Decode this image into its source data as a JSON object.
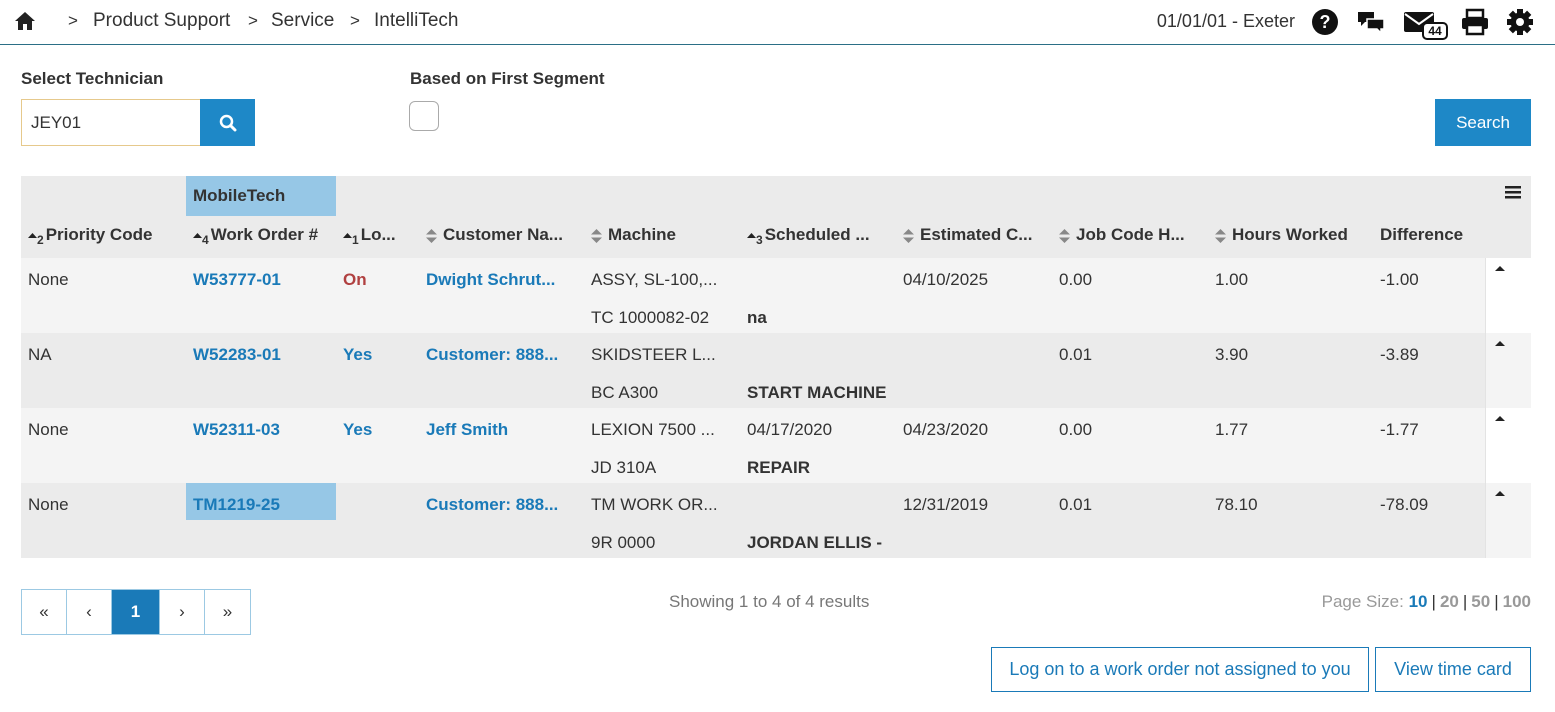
{
  "breadcrumb": {
    "separator": ">",
    "items": [
      "Product Support",
      "Service",
      "IntelliTech"
    ]
  },
  "header": {
    "location": "01/01/01 - Exeter",
    "mail_count": "44"
  },
  "filters": {
    "technician_label": "Select Technician",
    "technician_value": "JEY01",
    "first_segment_label": "Based on First Segment",
    "search_label": "Search"
  },
  "table": {
    "group_header": "MobileTech",
    "columns": [
      {
        "label": "Priority Code",
        "sort_order": "2"
      },
      {
        "label": "Work Order #",
        "sort_order": "4"
      },
      {
        "label": "Lo...",
        "sort_order": "1"
      },
      {
        "label": "Customer Na...",
        "sort_order": ""
      },
      {
        "label": "Machine",
        "sort_order": ""
      },
      {
        "label": "Scheduled ...",
        "sort_order": "3"
      },
      {
        "label": "Estimated C...",
        "sort_order": ""
      },
      {
        "label": "Job Code H...",
        "sort_order": ""
      },
      {
        "label": "Hours Worked",
        "sort_order": ""
      },
      {
        "label": "Difference",
        "sort_order": ""
      }
    ],
    "rows": [
      {
        "priority": "None",
        "work_order": "W53777-01",
        "logged": "On",
        "customer": "Dwight Schrut...",
        "machine": "ASSY, SL-100,...",
        "machine_code": "TC 1000082-02",
        "scheduled": "",
        "job_desc": "na",
        "estimated": "04/10/2025",
        "job_code_hours": "0.00",
        "hours_worked": "1.00",
        "difference": "-1.00"
      },
      {
        "priority": "NA",
        "work_order": "W52283-01",
        "logged": "Yes",
        "customer": "Customer: 888...",
        "machine": "SKIDSTEER L...",
        "machine_code": "BC A300",
        "scheduled": "",
        "job_desc": "START MACHINE",
        "estimated": "",
        "job_code_hours": "0.01",
        "hours_worked": "3.90",
        "difference": "-3.89"
      },
      {
        "priority": "None",
        "work_order": "W52311-03",
        "logged": "Yes",
        "customer": "Jeff Smith",
        "machine": "LEXION 7500 ...",
        "machine_code": "JD 310A",
        "scheduled": "04/17/2020",
        "job_desc": "REPAIR",
        "estimated": "04/23/2020",
        "job_code_hours": "0.00",
        "hours_worked": "1.77",
        "difference": "-1.77"
      },
      {
        "priority": "None",
        "work_order": "TM1219-25",
        "logged": "",
        "customer": "Customer: 888...",
        "machine": "TM WORK OR...",
        "machine_code": "9R 0000",
        "scheduled": "",
        "job_desc": "JORDAN ELLIS -",
        "estimated": "12/31/2019",
        "job_code_hours": "0.01",
        "hours_worked": "78.10",
        "difference": "-78.09"
      }
    ]
  },
  "pagination": {
    "first": "«",
    "prev": "‹",
    "current": "1",
    "next": "›",
    "last": "»",
    "showing": "Showing 1 to 4 of 4 results",
    "page_size_label": "Page Size:",
    "page_sizes": [
      "10",
      "20",
      "50",
      "100"
    ]
  },
  "actions": {
    "log_on_label": "Log on to a work order not assigned to you",
    "time_card_label": "View time card"
  },
  "colors": {
    "accent": "#1e88c7",
    "link": "#1a7ab8",
    "highlight": "#96c7e6",
    "logged_on": "#b04040"
  },
  "icons": [
    "home-icon",
    "help-icon",
    "chat-icon",
    "mail-icon",
    "print-icon",
    "gear-icon",
    "search-icon",
    "menu-icon",
    "sort-icon",
    "caret-up-icon"
  ]
}
